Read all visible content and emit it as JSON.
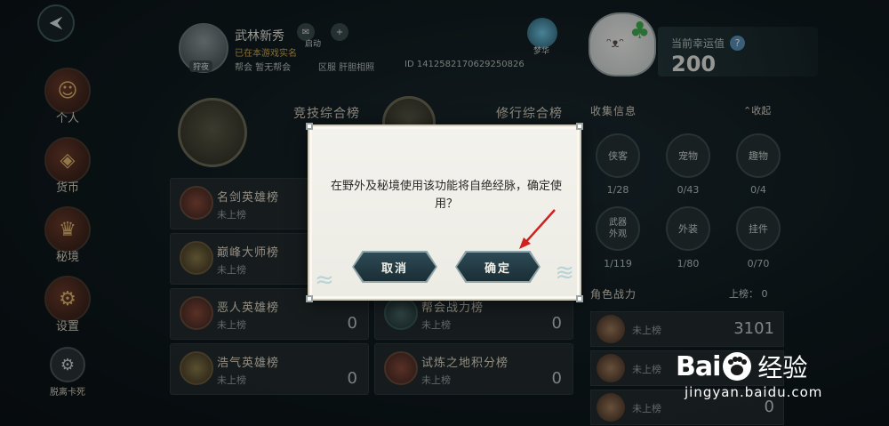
{
  "nav": {
    "back": "back-arrow-icon",
    "items": [
      {
        "label": "个人"
      },
      {
        "label": "货币"
      },
      {
        "label": "秘境"
      },
      {
        "label": "设置"
      },
      {
        "label": "脱离卡死"
      }
    ]
  },
  "profile": {
    "name": "武林新秀",
    "real_name_status": "已在本游戏实名",
    "guild": "帮会  暂无帮会",
    "region": "区服  肝胆相照",
    "id": "ID  1412582170629250826",
    "avatar_tag": "狩夜",
    "buttons": [
      {
        "label": "启动"
      },
      {
        "label": "+"
      }
    ],
    "moon_label": "梦华"
  },
  "luck": {
    "label": "当前幸运值",
    "value": "200",
    "help": "?"
  },
  "ranks": {
    "left_title": "竞技综合榜",
    "right_title": "修行综合榜",
    "left_cards": [
      {
        "name": "名剑英雄榜",
        "status": "未上榜",
        "score": ""
      },
      {
        "name": "巅峰大师榜",
        "status": "未上榜",
        "score": ""
      },
      {
        "name": "恶人英雄榜",
        "status": "未上榜",
        "score": "0"
      },
      {
        "name": "浩气英雄榜",
        "status": "未上榜",
        "score": "0"
      }
    ],
    "right_cards": [
      {
        "name": "帮会战力榜",
        "status": "未上榜",
        "score": "0"
      },
      {
        "name": "试炼之地积分榜",
        "status": "未上榜",
        "score": "0"
      }
    ]
  },
  "collection": {
    "title": "收集信息",
    "toggle": "收起",
    "items": [
      {
        "label": "侠客",
        "count": "1/28"
      },
      {
        "label": "宠物",
        "count": "0/43"
      },
      {
        "label": "趣物",
        "count": "0/4"
      },
      {
        "label": "武器外观",
        "count": "1/119"
      },
      {
        "label": "外装",
        "count": "1/80"
      },
      {
        "label": "挂件",
        "count": "0/70"
      }
    ]
  },
  "power": {
    "title": "角色战力",
    "rank": "上榜：  0",
    "rows": [
      {
        "status": "未上榜",
        "value": "3101"
      },
      {
        "status": "未上榜",
        "value": ""
      },
      {
        "status": "未上榜",
        "value": "0"
      }
    ]
  },
  "dialog": {
    "message": "在野外及秘境使用该功能将自绝经脉，确定使用？",
    "cancel": "取消",
    "confirm": "确定"
  },
  "watermark": {
    "brand_left": "Bai",
    "brand_right": "经验",
    "url": "jingyan.baidu.com"
  }
}
